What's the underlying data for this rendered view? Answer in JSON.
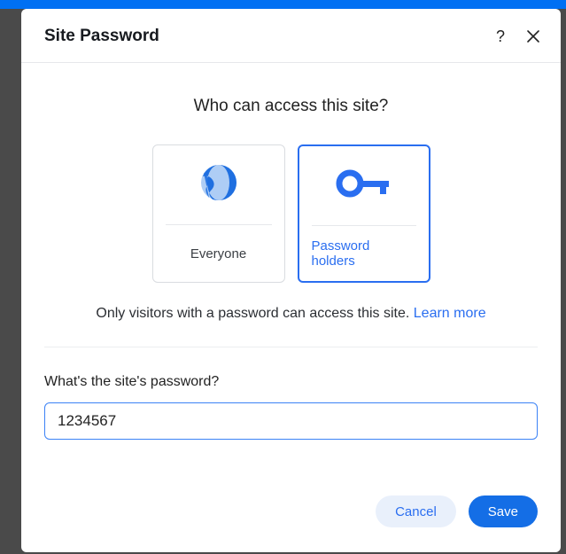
{
  "dialog": {
    "title": "Site Password",
    "question": "Who can access this site?",
    "options": {
      "everyone": {
        "label": "Everyone"
      },
      "password_holders": {
        "label": "Password holders"
      }
    },
    "description": "Only visitors with a password can access this site.",
    "learn_more": "Learn more",
    "password_field": {
      "label": "What's the site's password?",
      "value": "1234567"
    },
    "buttons": {
      "cancel": "Cancel",
      "save": "Save"
    }
  }
}
